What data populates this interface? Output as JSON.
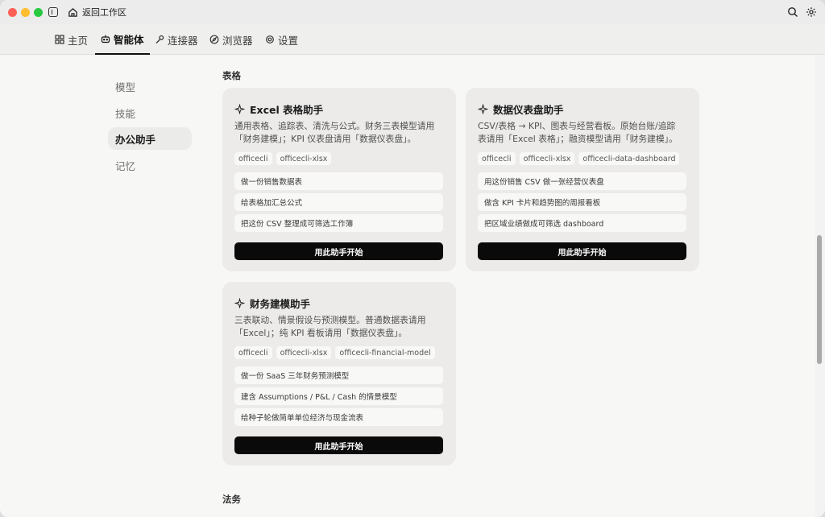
{
  "titlebar": {
    "back_label": "返回工作区"
  },
  "topnav": {
    "tabs": [
      {
        "label": "主页"
      },
      {
        "label": "智能体"
      },
      {
        "label": "连接器"
      },
      {
        "label": "浏览器"
      },
      {
        "label": "设置"
      }
    ]
  },
  "leftnav": {
    "items": [
      {
        "label": "模型"
      },
      {
        "label": "技能"
      },
      {
        "label": "办公助手"
      },
      {
        "label": "记忆"
      }
    ]
  },
  "sections": {
    "sheets_title": "表格",
    "legal_title": "法务"
  },
  "cards": [
    {
      "title": "Excel 表格助手",
      "desc_line1": "通用表格、追踪表、清洗与公式。财务三表模型请用",
      "desc_line2": "「财务建模」；KPI 仪表盘请用「数据仪表盘」。",
      "tags": [
        "officecli",
        "officecli-xlsx"
      ],
      "prompts": [
        "做一份销售数据表",
        "给表格加汇总公式",
        "把这份 CSV 整理成可筛选工作簿"
      ],
      "button": "用此助手开始"
    },
    {
      "title": "数据仪表盘助手",
      "desc_line1": "CSV/表格 → KPI、图表与经营看板。原始台账/追踪",
      "desc_line2": "表请用「Excel 表格」；融资模型请用「财务建模」。",
      "tags": [
        "officecli",
        "officecli-xlsx",
        "officecli-data-dashboard"
      ],
      "prompts": [
        "用这份销售 CSV 做一张经营仪表盘",
        "做含 KPI 卡片和趋势图的周报看板",
        "把区域业绩做成可筛选 dashboard"
      ],
      "button": "用此助手开始"
    },
    {
      "title": "财务建模助手",
      "desc_line1": "三表联动、情景假设与预测模型。普通数据表请用",
      "desc_line2": "「Excel」；纯 KPI 看板请用「数据仪表盘」。",
      "tags": [
        "officecli",
        "officecli-xlsx",
        "officecli-financial-model"
      ],
      "prompts": [
        "做一份 SaaS 三年财务预测模型",
        "建含 Assumptions / P&L / Cash 的情景模型",
        "给种子轮做简单单位经济与现金流表"
      ],
      "button": "用此助手开始"
    }
  ]
}
